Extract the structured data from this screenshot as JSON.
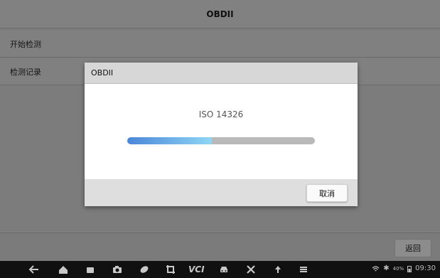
{
  "window": {
    "title": "OBDII"
  },
  "menu": {
    "items": [
      {
        "label": "开始检测"
      },
      {
        "label": "检测记录"
      }
    ]
  },
  "footer": {
    "back_label": "返回"
  },
  "dialog": {
    "title": "OBDII",
    "message": "ISO 14326",
    "progress_percent": 45,
    "cancel_label": "取消"
  },
  "navbar": {
    "icons": [
      "back-arrow-icon",
      "home-icon",
      "recent-apps-icon",
      "camera-icon",
      "browser-icon",
      "crop-icon",
      "vci-icon",
      "car-icon",
      "tools-icon",
      "upload-icon",
      "menu-icon"
    ],
    "vci_label": "VCI",
    "battery_percent": "40%",
    "time": "09:30"
  }
}
